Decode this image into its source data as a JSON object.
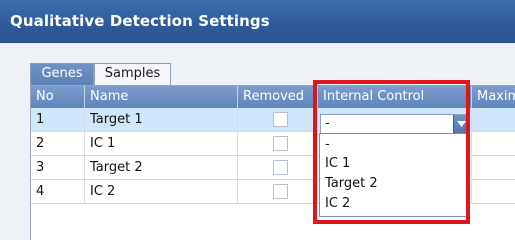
{
  "window": {
    "title": "Qualitative Detection Settings"
  },
  "tabs": [
    {
      "label": "Genes",
      "active": true
    },
    {
      "label": "Samples",
      "active": false
    }
  ],
  "columns": [
    "No",
    "Name",
    "Removed",
    "Internal Control",
    "Maxim"
  ],
  "rows": [
    {
      "no": "1",
      "name": "Target 1",
      "removed": false,
      "internal_control": "-",
      "selected": true
    },
    {
      "no": "2",
      "name": "IC 1",
      "removed": false,
      "internal_control": "",
      "selected": false
    },
    {
      "no": "3",
      "name": "Target 2",
      "removed": false,
      "internal_control": "",
      "selected": false
    },
    {
      "no": "4",
      "name": "IC 2",
      "removed": false,
      "internal_control": "",
      "selected": false
    }
  ],
  "combo": {
    "value": "-",
    "icon": "chevron-down-icon"
  },
  "dropdown": {
    "options": [
      "-",
      "IC 1",
      "Target 2",
      "IC 2"
    ]
  },
  "colors": {
    "title_bar": "#2f5b9a",
    "selection": "#cfe6fb",
    "highlight": "#e0141b"
  }
}
